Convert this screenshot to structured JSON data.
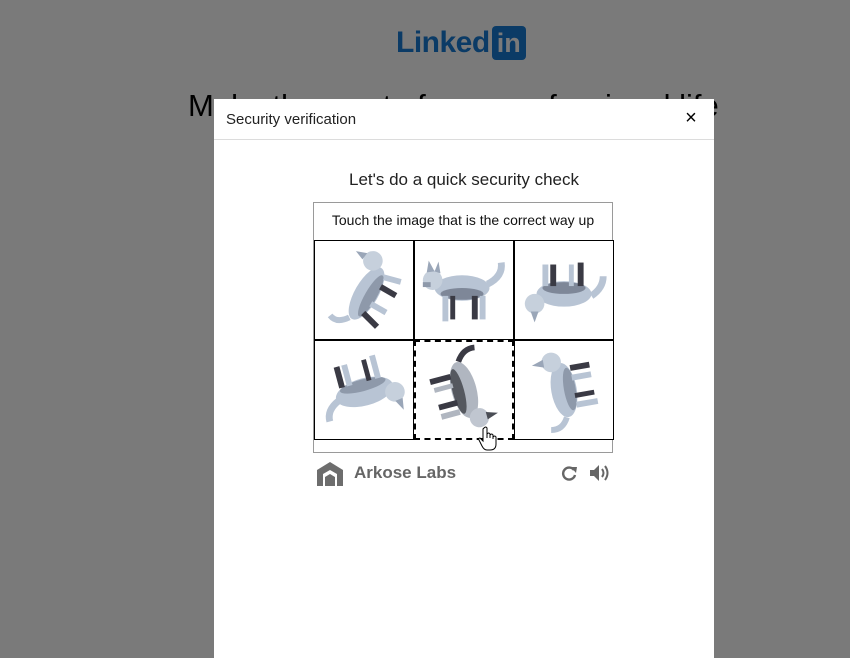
{
  "background": {
    "logo": {
      "word": "Linked",
      "badge": "in"
    },
    "headline": "Make the most of your professional life"
  },
  "modal": {
    "title": "Security verification",
    "close_label": "×",
    "check_title": "Let's do a quick security check",
    "instruction": "Touch the image that is the correct way up",
    "tiles": [
      {
        "id": "tile-1",
        "icon": "rotated-dog-image",
        "selected": false
      },
      {
        "id": "tile-2",
        "icon": "upright-dog-image",
        "selected": false
      },
      {
        "id": "tile-3",
        "icon": "upside-down-dog-image",
        "selected": false
      },
      {
        "id": "tile-4",
        "icon": "upside-down-dog-image",
        "selected": false
      },
      {
        "id": "tile-5",
        "icon": "rotated-dog-image",
        "selected": true
      },
      {
        "id": "tile-6",
        "icon": "rotated-dog-image",
        "selected": false
      }
    ],
    "footer": {
      "brand": "Arkose Labs",
      "refresh_icon": "refresh-icon",
      "audio_icon": "speaker-icon"
    }
  },
  "colors": {
    "overlay": "#7a7a7a",
    "linkedin_blue": "#0b3b66",
    "dog_fill": "#b8c4d4",
    "dog_shadow": "#3a3a44"
  }
}
